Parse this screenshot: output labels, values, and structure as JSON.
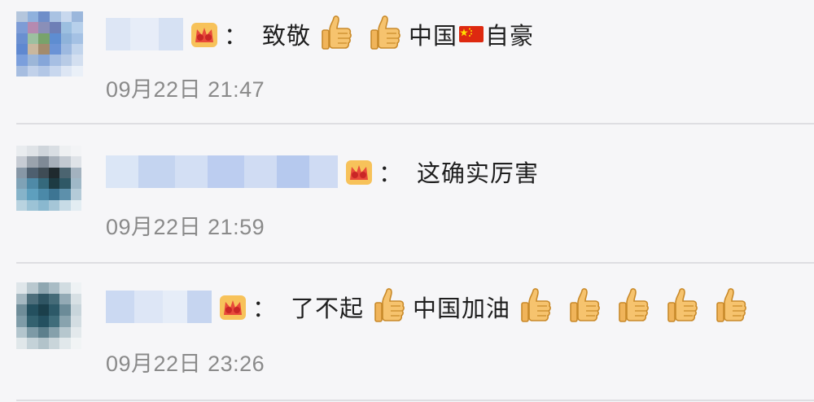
{
  "comments": [
    {
      "segments_before": "致敬",
      "middle": "中国",
      "segments_after": "自豪",
      "time": "09月22日 21:47"
    },
    {
      "text": "这确实厉害",
      "time": "09月22日 21:59"
    },
    {
      "text1": "了不起",
      "text2": "中国加油",
      "time": "09月22日 23:26"
    }
  ],
  "separator": "：",
  "icons": {
    "thumb": "thumbs-up-icon",
    "flag": "china-flag-icon",
    "badge": "crown-badge-icon"
  },
  "colors": {
    "background": "#f6f6f8",
    "text": "#1f1f1f",
    "timestamp": "#8a8a8a",
    "divider": "#dedee2",
    "username_blur": "#c9d6ee"
  }
}
